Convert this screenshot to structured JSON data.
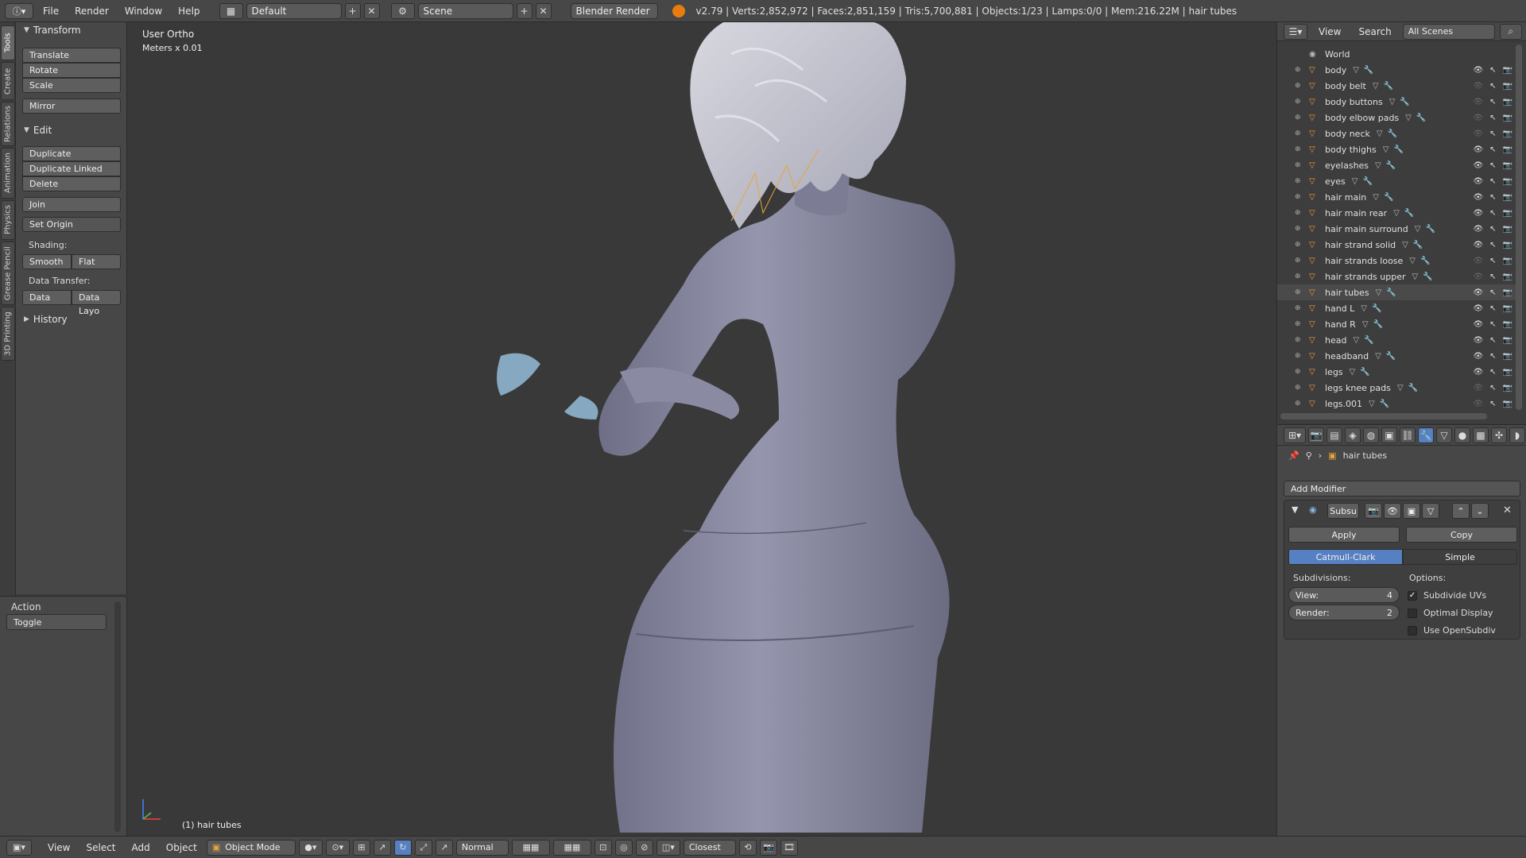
{
  "topbar": {
    "menus": [
      "File",
      "Render",
      "Window",
      "Help"
    ],
    "screen_layout": "Default",
    "scene": "Scene",
    "render_engine": "Blender Render",
    "stats": "v2.79 | Verts:2,852,972 | Faces:2,851,159 | Tris:5,700,881 | Objects:1/23 | Lamps:0/0 | Mem:216.22M | hair tubes"
  },
  "vtabs": [
    "Tools",
    "Create",
    "Relations",
    "Animation",
    "Physics",
    "Grease Pencil",
    "3D Printing"
  ],
  "toolshelf": {
    "transform_title": "Transform",
    "translate": "Translate",
    "rotate": "Rotate",
    "scale": "Scale",
    "mirror": "Mirror",
    "edit_title": "Edit",
    "duplicate": "Duplicate",
    "duplicate_linked": "Duplicate Linked",
    "delete": "Delete",
    "join": "Join",
    "set_origin": "Set Origin",
    "shading_label": "Shading:",
    "smooth": "Smooth",
    "flat": "Flat",
    "data_transfer_label": "Data Transfer:",
    "data": "Data",
    "data_layout": "Data Layo",
    "history_title": "History"
  },
  "action_panel": {
    "title": "Action",
    "value": "Toggle"
  },
  "viewport": {
    "view_name": "User Ortho",
    "units": "Meters x 0.01",
    "active_object": "(1) hair tubes"
  },
  "outliner": {
    "menu_view": "View",
    "menu_search": "Search",
    "scene_filter": "All Scenes",
    "world": "World",
    "items": [
      {
        "name": "body",
        "visible": true
      },
      {
        "name": "body belt",
        "visible": false
      },
      {
        "name": "body buttons",
        "visible": false
      },
      {
        "name": "body elbow pads",
        "visible": false
      },
      {
        "name": "body neck",
        "visible": false
      },
      {
        "name": "body thighs",
        "visible": true
      },
      {
        "name": "eyelashes",
        "visible": true
      },
      {
        "name": "eyes",
        "visible": true
      },
      {
        "name": "hair main",
        "visible": true
      },
      {
        "name": "hair main rear",
        "visible": true
      },
      {
        "name": "hair main surround",
        "visible": true
      },
      {
        "name": "hair strand solid",
        "visible": true
      },
      {
        "name": "hair strands loose",
        "visible": false
      },
      {
        "name": "hair strands upper",
        "visible": false
      },
      {
        "name": "hair tubes",
        "visible": true
      },
      {
        "name": "hand L",
        "visible": true
      },
      {
        "name": "hand R",
        "visible": true
      },
      {
        "name": "head",
        "visible": true
      },
      {
        "name": "headband",
        "visible": true
      },
      {
        "name": "legs",
        "visible": true
      },
      {
        "name": "legs knee pads",
        "visible": false
      },
      {
        "name": "legs.001",
        "visible": false
      }
    ]
  },
  "properties": {
    "context_object": "hair tubes",
    "add_modifier": "Add Modifier",
    "modifier_name": "Subsu",
    "apply": "Apply",
    "copy": "Copy",
    "catmull_clark": "Catmull-Clark",
    "simple": "Simple",
    "subdivisions_label": "Subdivisions:",
    "options_label": "Options:",
    "view_label": "View:",
    "view_value": "4",
    "render_label": "Render:",
    "render_value": "2",
    "subdivide_uvs": "Subdivide UVs",
    "optimal_display": "Optimal Display",
    "use_opensubdiv": "Use OpenSubdiv"
  },
  "bottombar": {
    "menus": [
      "View",
      "Select",
      "Add",
      "Object"
    ],
    "mode": "Object Mode",
    "pivot": "Normal",
    "snap": "Closest"
  }
}
